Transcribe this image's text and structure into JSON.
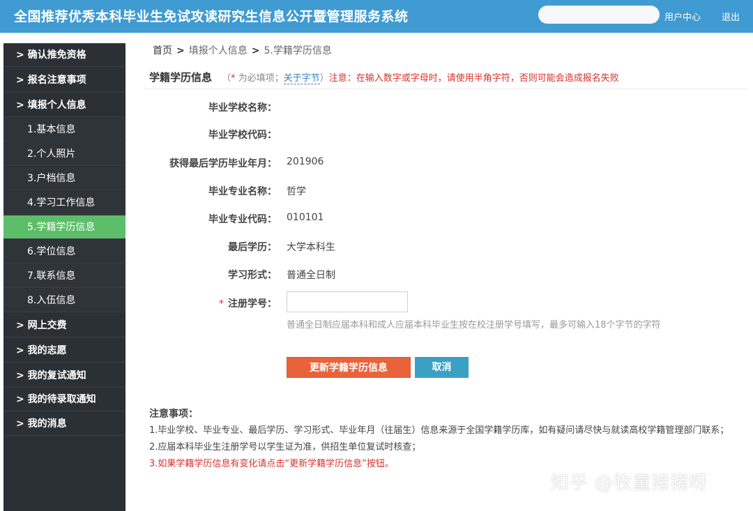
{
  "header": {
    "title": "全国推荐优秀本科毕业生免试攻读研究生信息公开暨管理服务系统",
    "user_center": "用户中心",
    "logout": "退出"
  },
  "sidebar": {
    "items": [
      {
        "label": "> 确认推免资格"
      },
      {
        "label": "> 报名注意事项"
      },
      {
        "label": "> 填报个人信息"
      },
      {
        "label": "1.基本信息"
      },
      {
        "label": "2.个人照片"
      },
      {
        "label": "3.户档信息"
      },
      {
        "label": "4.学习工作信息"
      },
      {
        "label": "5.学籍学历信息"
      },
      {
        "label": "6.学位信息"
      },
      {
        "label": "7.联系信息"
      },
      {
        "label": "8.入伍信息"
      },
      {
        "label": "> 网上交费"
      },
      {
        "label": "> 我的志愿"
      },
      {
        "label": "> 我的复试通知"
      },
      {
        "label": "> 我的待录取通知"
      },
      {
        "label": "> 我的消息"
      }
    ]
  },
  "breadcrumb": {
    "home": "首页",
    "sep": ">",
    "level2": "填报个人信息",
    "current": "5.学籍学历信息"
  },
  "section": {
    "title": "学籍学历信息",
    "paren_open": "（",
    "star": "*",
    "required_text": " 为必填项；",
    "about_bytes": "关于字节",
    "paren_close": "）",
    "warning": "注意：在输入数字或字母时，请使用半角字符，否则可能会造成报名失败"
  },
  "form": {
    "school_name": {
      "label": "毕业学校名称：",
      "value": ""
    },
    "school_code": {
      "label": "毕业学校代码：",
      "value": ""
    },
    "grad_date": {
      "label": "获得最后学历毕业年月：",
      "value": "201906"
    },
    "major_name": {
      "label": "毕业专业名称：",
      "value": "哲学"
    },
    "major_code": {
      "label": "毕业专业代码：",
      "value": "010101"
    },
    "last_degree": {
      "label": "最后学历：",
      "value": "大学本科生"
    },
    "study_form": {
      "label": "学习形式：",
      "value": "普通全日制"
    },
    "student_id": {
      "star": "*",
      "label": "注册学号：",
      "value": "",
      "hint": "普通全日制应届本科和成人应届本科毕业生按在校注册学号填写，最多可输入18个字节的字符"
    }
  },
  "buttons": {
    "update": "更新学籍学历信息",
    "cancel": "取消"
  },
  "notes": {
    "title": "注意事项：",
    "items": [
      "1.毕业学校、毕业专业、最后学历、学习形式、毕业年月（往届生）信息来源于全国学籍学历库，如有疑问请尽快与就读高校学籍管理部门联系；",
      "2.应届本科毕业生注册学号以学生证为准，供招生单位复试时核查；",
      "3.如果学籍学历信息有变化请点击“更新学籍学历信息”按钮。"
    ]
  },
  "watermark": "知乎 @牧童猪猪呀",
  "colors": {
    "header_bg": "#3f9bd1",
    "sidebar_bg": "#2b3034",
    "sidebar_active": "#5dbe6a",
    "button_update": "#e8633a",
    "button_cancel": "#3aa0c4",
    "warning_red": "#d9302b"
  }
}
